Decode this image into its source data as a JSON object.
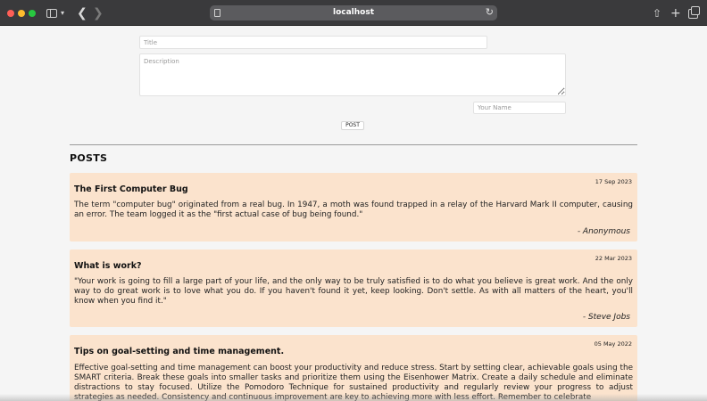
{
  "browser": {
    "url": "localhost"
  },
  "form": {
    "title_placeholder": "Title",
    "description_placeholder": "Description",
    "name_placeholder": "Your Name",
    "post_button": "POST"
  },
  "posts_heading": "POSTS",
  "posts": [
    {
      "date": "17 Sep 2023",
      "title": "The First Computer Bug",
      "body": "The term \"computer bug\" originated from a real bug. In 1947, a moth was found trapped in a relay of the Harvard Mark II computer, causing an error. The team logged it as the \"first actual case of bug being found.\"",
      "author": "- Anonymous"
    },
    {
      "date": "22 Mar 2023",
      "title": "What is work?",
      "body": "\"Your work is going to fill a large part of your life, and the only way to be truly satisfied is to do what you believe is great work. And the only way to do great work is to love what you do. If you haven't found it yet, keep looking. Don't settle. As with all matters of the heart, you'll know when you find it.\"",
      "author": "- Steve Jobs"
    },
    {
      "date": "05 May 2022",
      "title": "Tips on goal-setting and time management.",
      "body": "Effective goal-setting and time management can boost your productivity and reduce stress. Start by setting clear, achievable goals using the SMART criteria. Break these goals into smaller tasks and prioritize them using the Eisenhower Matrix. Create a daily schedule and eliminate distractions to stay focused. Utilize the Pomodoro Technique for sustained productivity and regularly review your progress to adjust strategies as needed. Consistency and continuous improvement are key to achieving more with less effort. Remember to celebrate",
      "author": ""
    }
  ],
  "icons": {
    "sidebar": "sidebar-icon",
    "back": "chevron-left-icon",
    "forward": "chevron-right-icon",
    "reload": "reload-icon",
    "share": "share-icon",
    "new_tab": "plus-icon",
    "tabs": "tabs-overview-icon"
  }
}
